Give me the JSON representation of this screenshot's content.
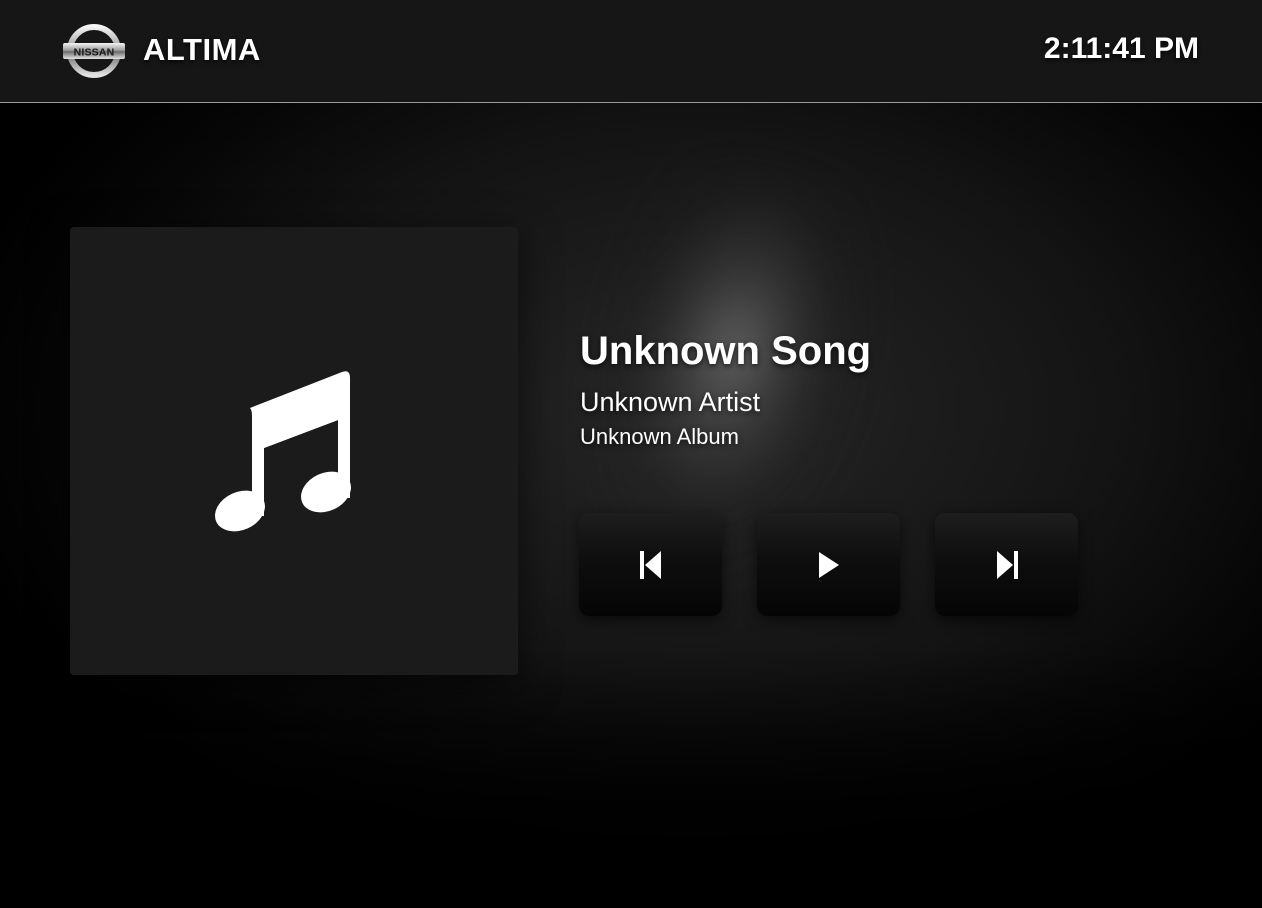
{
  "header": {
    "brand_logo_text": "NISSAN",
    "title": "ALTIMA",
    "clock": "2:11:41 PM"
  },
  "now_playing": {
    "song": "Unknown Song",
    "artist": "Unknown Artist",
    "album": "Unknown Album",
    "album_art_icon": "music-note-icon"
  },
  "controls": {
    "previous_icon": "skip-previous-icon",
    "play_icon": "play-icon",
    "next_icon": "skip-next-icon"
  },
  "colors": {
    "header_bg": "#161616",
    "header_border": "#9a9a9a",
    "album_art_bg": "#1b1b1b",
    "text": "#ffffff"
  }
}
